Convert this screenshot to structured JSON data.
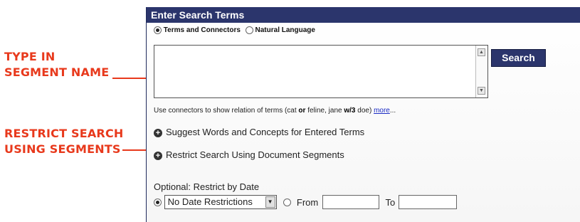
{
  "callouts": {
    "type_in_line1": "TYPE IN",
    "type_in_line2": "SEGMENT NAME",
    "restrict_line1": "RESTRICT SEARCH",
    "restrict_line2": "USING SEGMENTS",
    "accent_color": "#e8391c"
  },
  "panel": {
    "title": "Enter Search Terms",
    "mode_options": [
      {
        "label": "Terms and Connectors",
        "selected": true
      },
      {
        "label": "Natural Language",
        "selected": false
      }
    ],
    "search_button": "Search",
    "connectors_pre": "Use connectors to show relation of terms (cat ",
    "connectors_or": "or",
    "connectors_mid": " feline, jane ",
    "connectors_w3": "w/3",
    "connectors_post": " doe) ",
    "more_link": "more",
    "more_ellipsis": "...",
    "suggest_label": "Suggest Words and Concepts for Entered Terms",
    "restrict_segments_label": "Restrict Search Using Document Segments",
    "date_heading": "Optional: Restrict by Date",
    "date_select_value": "No Date Restrictions",
    "from_label": "From",
    "to_label": "To",
    "header_color": "#2b356c"
  }
}
